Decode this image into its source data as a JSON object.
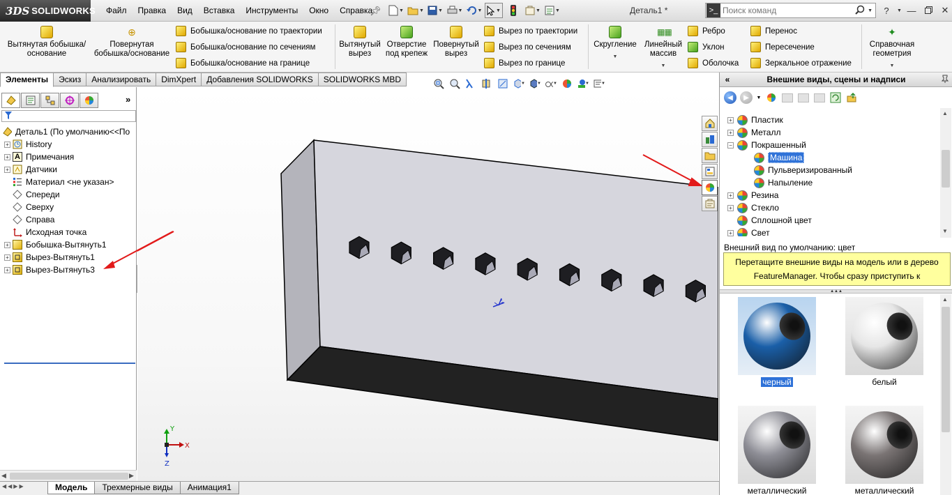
{
  "app": {
    "brand_prefix": "3DS",
    "brand_name": "SOLIDWORKS",
    "document_title": "Деталь1 *"
  },
  "menu": [
    "Файл",
    "Правка",
    "Вид",
    "Вставка",
    "Инструменты",
    "Окно",
    "Справка"
  ],
  "search": {
    "placeholder": "Поиск команд"
  },
  "command_manager": {
    "features": {
      "extruded_boss": "Вытянутая бобышка/основание",
      "revolved_boss": "Повернутая бобышка/основание",
      "swept_boss": "Бобышка/основание по траектории",
      "lofted_boss": "Бобышка/основание по сечениям",
      "boundary_boss": "Бобышка/основание на границе",
      "extruded_cut": "Вытянутый вырез",
      "hole_wizard": "Отверстие под крепеж",
      "revolved_cut": "Повернутый вырез",
      "swept_cut": "Вырез по траектории",
      "lofted_cut": "Вырез по сечениям",
      "boundary_cut": "Вырез по границе",
      "fillet": "Скругление",
      "linear_pattern": "Линейный массив",
      "rib": "Ребро",
      "draft": "Уклон",
      "shell": "Оболочка",
      "wrap": "Перенос",
      "intersect": "Пересечение",
      "mirror": "Зеркальное отражение",
      "reference_geometry": "Справочная геометрия"
    }
  },
  "tabs": [
    "Элементы",
    "Эскиз",
    "Анализировать",
    "DimXpert",
    "Добавления SOLIDWORKS",
    "SOLIDWORKS MBD"
  ],
  "active_tab": "Элементы",
  "feature_tree": {
    "root": "Деталь1  (По умолчанию<<По",
    "items": [
      {
        "label": "History",
        "icon": "history-icon"
      },
      {
        "label": "Примечания",
        "icon": "annotations-icon"
      },
      {
        "label": "Датчики",
        "icon": "sensors-icon"
      },
      {
        "label": "Материал <не указан>",
        "icon": "material-icon"
      },
      {
        "label": "Спереди",
        "icon": "plane-icon"
      },
      {
        "label": "Сверху",
        "icon": "plane-icon"
      },
      {
        "label": "Справа",
        "icon": "plane-icon"
      },
      {
        "label": "Исходная точка",
        "icon": "origin-icon"
      },
      {
        "label": "Бобышка-Вытянуть1",
        "icon": "boss-extrude-icon"
      },
      {
        "label": "Вырез-Вытянуть1",
        "icon": "cut-extrude-icon"
      },
      {
        "label": "Вырез-Вытянуть3",
        "icon": "cut-extrude-icon"
      }
    ]
  },
  "task_pane": {
    "title": "Внешние виды, сцены и надписи",
    "tree": [
      {
        "label": "Пластик",
        "level": 1
      },
      {
        "label": "Металл",
        "level": 1
      },
      {
        "label": "Покрашенный",
        "level": 1,
        "expanded": true
      },
      {
        "label": "Машина",
        "level": 2,
        "selected": true
      },
      {
        "label": "Пульверизированный",
        "level": 2
      },
      {
        "label": "Напыление",
        "level": 2
      },
      {
        "label": "Резина",
        "level": 1
      },
      {
        "label": "Стекло",
        "level": 1
      },
      {
        "label": "Сплошной цвет",
        "level": 1
      },
      {
        "label": "Свет",
        "level": 1
      }
    ],
    "default_appearance": "Внешний вид по умолчанию: цвет",
    "hint": "Перетащите внешние виды на модель или в дерево FeatureManager.  Чтобы сразу приступить к редактиров...",
    "swatches": [
      {
        "label": "черный",
        "color": "#1a5fa8",
        "selected": true
      },
      {
        "label": "белый",
        "color": "#e6e6e6",
        "selected": false
      },
      {
        "label": "металлический",
        "color": "#8e8e96",
        "selected": false
      },
      {
        "label": "металлический",
        "color": "#7a7474",
        "selected": false
      }
    ]
  },
  "triad": {
    "x": "X",
    "y": "Y",
    "z": "Z"
  },
  "bottom_tabs": [
    "Модель",
    "Трехмерные виды",
    "Анимация1"
  ],
  "active_bottom_tab": "Модель",
  "colors": {
    "selection": "#2f72d8",
    "annotation_arrow": "#e21a1a",
    "hint_background": "#ffff9e"
  }
}
